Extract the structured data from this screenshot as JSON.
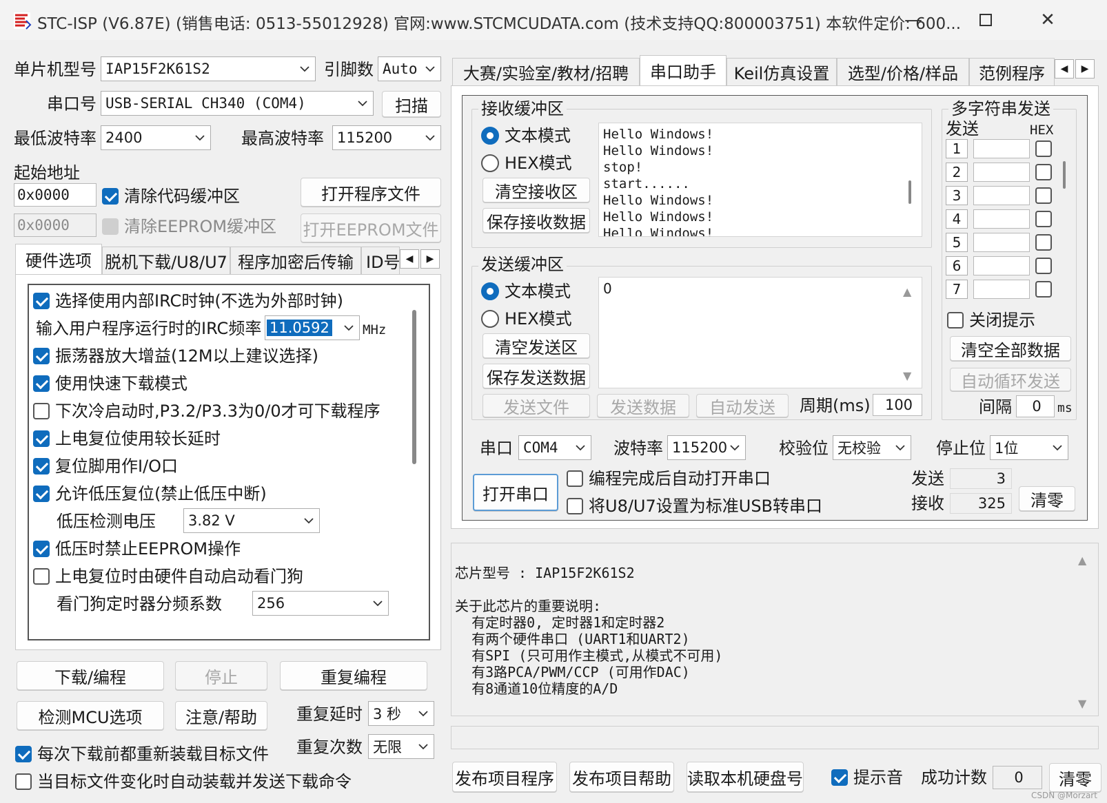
{
  "window": {
    "title": "STC-ISP (V6.87E) (销售电话: 0513-55012928) 官网:www.STCMCUDATA.com  (技术支持QQ:800003751) 本软件定价: 600...",
    "min_icon": "minimize-icon",
    "max_icon": "maximize-icon",
    "close_icon": "close-icon"
  },
  "left": {
    "mcu_label": "单片机型号",
    "mcu_value": "IAP15F2K61S2",
    "pin_label": "引脚数",
    "pin_value": "Auto",
    "port_label": "串口号",
    "port_value": "USB-SERIAL CH340 (COM4)",
    "scan_btn": "扫描",
    "min_baud_label": "最低波特率",
    "min_baud_value": "2400",
    "max_baud_label": "最高波特率",
    "max_baud_value": "115200",
    "start_addr_label": "起始地址",
    "addr1": "0x0000",
    "clear_code": "清除代码缓冲区",
    "open_prog": "打开程序文件",
    "addr2": "0x0000",
    "clear_eeprom": "清除EEPROM缓冲区",
    "open_eeprom": "打开EEPROM文件",
    "tabs": [
      "硬件选项",
      "脱机下载/U8/U7",
      "程序加密后传输",
      "ID号"
    ],
    "hw_options": {
      "opt1": "选择使用内部IRC时钟(不选为外部时钟)",
      "irc_label": "输入用户程序运行时的IRC频率",
      "irc_value": "11.0592",
      "irc_unit": "MHz",
      "opt2": "振荡器放大增益(12M以上建议选择)",
      "opt3": "使用快速下载模式",
      "opt4": "下次冷启动时,P3.2/P3.3为0/0才可下载程序",
      "opt5": "上电复位使用较长延时",
      "opt6": "复位脚用作I/O口",
      "opt7": "允许低压复位(禁止低压中断)",
      "lv_label": "低压检测电压",
      "lv_value": "3.82 V",
      "opt8": "低压时禁止EEPROM操作",
      "opt9": "上电复位时由硬件自动启动看门狗",
      "wdt_label": "看门狗定时器分频系数",
      "wdt_value": "256"
    },
    "download_btn": "下载/编程",
    "stop_btn": "停止",
    "reprogram_btn": "重复编程",
    "detect_btn": "检测MCU选项",
    "help_btn": "注意/帮助",
    "repeat_delay_label": "重复延时",
    "repeat_delay_value": "3 秒",
    "repeat_count_label": "重复次数",
    "repeat_count_value": "无限",
    "reload_label": "每次下载前都重新装载目标文件",
    "auto_load_label": "当目标文件变化时自动装载并发送下载命令"
  },
  "right": {
    "tabs": [
      "大赛/实验室/教材/招聘",
      "串口助手",
      "Keil仿真设置",
      "选型/价格/样品",
      "范例程序"
    ],
    "recv": {
      "title": "接收缓冲区",
      "text_mode": "文本模式",
      "hex_mode": "HEX模式",
      "clear_btn": "清空接收区",
      "save_btn": "保存接收数据",
      "lines": [
        "Hello Windows!",
        "Hello Windows!",
        "stop!",
        "start......",
        "Hello Windows!",
        "Hello Windows!",
        "Hello Windows!"
      ]
    },
    "send": {
      "title": "发送缓冲区",
      "text_mode": "文本模式",
      "hex_mode": "HEX模式",
      "clear_btn": "清空发送区",
      "save_btn": "保存发送数据",
      "content": "0",
      "send_file": "发送文件",
      "send_data": "发送数据",
      "auto_send": "自动发送",
      "period_label": "周期(ms)",
      "period_value": "100"
    },
    "multi": {
      "title": "多字符串发送",
      "send_col": "发送",
      "hex_col": "HEX",
      "rows": [
        "1",
        "2",
        "3",
        "4",
        "5",
        "6",
        "7"
      ],
      "close_tip": "关闭提示",
      "clear_all": "清空全部数据",
      "auto_loop": "自动循环发送",
      "interval_label": "间隔",
      "interval_value": "0",
      "interval_unit": "ms"
    },
    "serial": {
      "port_label": "串口",
      "port_value": "COM4",
      "baud_label": "波特率",
      "baud_value": "115200",
      "parity_label": "校验位",
      "parity_value": "无校验",
      "stop_label": "停止位",
      "stop_value": "1位",
      "open_btn": "打开串口",
      "auto_open": "编程完成后自动打开串口",
      "usb_set": "将U8/U7设置为标准USB转串口",
      "send_label": "发送",
      "send_count": "3",
      "recv_label": "接收",
      "recv_count": "325",
      "clear_btn": "清零"
    },
    "info": {
      "lines": [
        "芯片型号 : IAP15F2K61S2",
        "",
        "关于此芯片的重要说明:",
        "  有定时器0, 定时器1和定时器2",
        "  有两个硬件串口 (UART1和UART2)",
        "  有SPI (只可用作主模式,从模式不可用)",
        "  有3路PCA/PWM/CCP (可用作DAC)",
        "  有8通道10位精度的A/D"
      ]
    },
    "bottom": {
      "publish_prog": "发布项目程序",
      "publish_help": "发布项目帮助",
      "read_disk": "读取本机硬盘号",
      "sound_label": "提示音",
      "success_label": "成功计数",
      "success_value": "0",
      "clear_btn": "清零"
    },
    "watermark": "CSDN @Morzart"
  }
}
